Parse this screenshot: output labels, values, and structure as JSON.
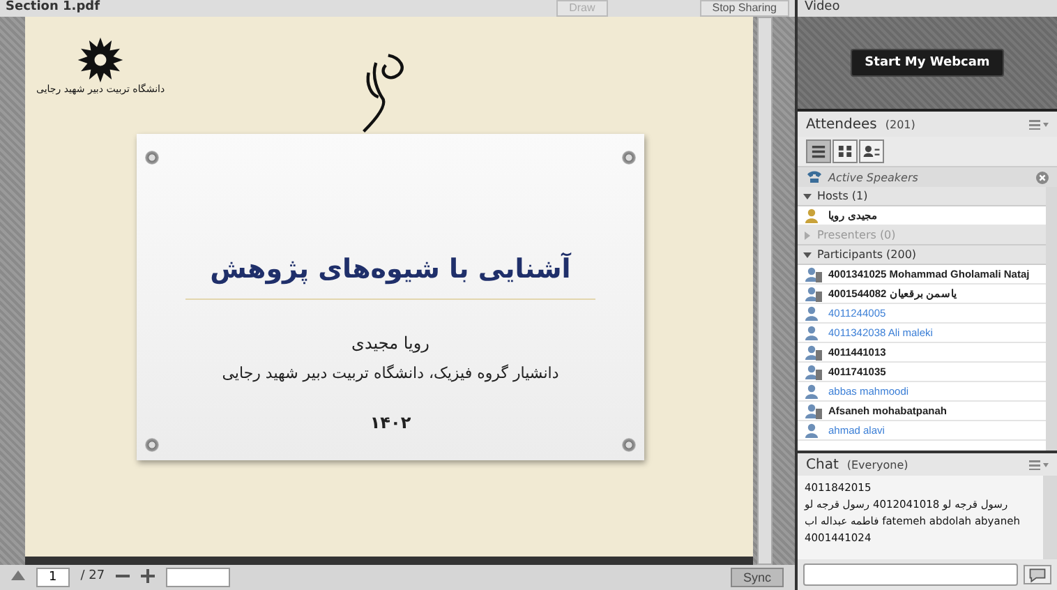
{
  "document": {
    "title": "Section 1.pdf",
    "toolbar": [
      {
        "label": "Draw",
        "disabled": true
      },
      {
        "label": "Stop Sharing",
        "disabled": false
      }
    ]
  },
  "slide": {
    "logo_caption": "دانشگاه تربیت دبیر شهید رجایی",
    "title": "آشنایی با شیوه‌های پژوهش",
    "author": "رویا مجیدی",
    "affiliation": "دانشیار گروه فیزیک، دانشگاه تربیت دبیر شهید رجایی",
    "year": "۱۴۰۲"
  },
  "pager": {
    "page": "1",
    "total": "/ 27",
    "sync": "Sync"
  },
  "video": {
    "title": "Video",
    "button": "Start My Webcam"
  },
  "attendees": {
    "title": "Attendees",
    "count": "(201)",
    "active_speakers": "Active Speakers",
    "groups": [
      {
        "label": "Hosts (1)",
        "expanded": true,
        "members": [
          {
            "name": "مجیدی رویا",
            "kind": "host"
          }
        ]
      },
      {
        "label": "Presenters (0)",
        "expanded": false
      },
      {
        "label": "Participants (200)",
        "expanded": true,
        "members": [
          {
            "name": "4001341025 Mohammad Gholamali Nataj",
            "kind": "device"
          },
          {
            "name": "4001544082 یاسمن برقعیان",
            "kind": "device"
          },
          {
            "name": "4011244005",
            "kind": "guest"
          },
          {
            "name": "4011342038 Ali maleki",
            "kind": "guest"
          },
          {
            "name": "4011441013",
            "kind": "device"
          },
          {
            "name": "4011741035",
            "kind": "device"
          },
          {
            "name": "abbas mahmoodi",
            "kind": "guest"
          },
          {
            "name": "Afsaneh mohabatpanah",
            "kind": "device"
          },
          {
            "name": "ahmad alavi",
            "kind": "guest"
          }
        ]
      }
    ]
  },
  "chat": {
    "title": "Chat",
    "audience": "(Everyone)",
    "messages": [
      "4011842015",
      "رسول قرجه لو 4012041018 رسول قرجه لو",
      "فاطمه عبداله اب  fatemeh abdolah abyaneh",
      "4001441024"
    ]
  }
}
